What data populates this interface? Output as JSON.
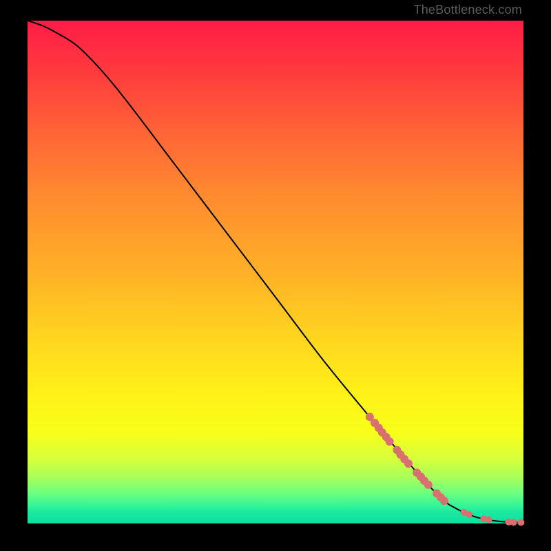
{
  "watermark": "TheBottleneck.com",
  "marker_color": "#d87070",
  "line_color": "#000000",
  "chart_data": {
    "type": "line",
    "title": "",
    "xlabel": "",
    "ylabel": "",
    "xlim": [
      0,
      100
    ],
    "ylim": [
      0,
      100
    ],
    "series": [
      {
        "name": "curve",
        "x": [
          0,
          3,
          6,
          10,
          15,
          20,
          30,
          40,
          50,
          60,
          70,
          76,
          80,
          84,
          86,
          88,
          90,
          92,
          94,
          96,
          98,
          100
        ],
        "y": [
          100,
          99,
          97.5,
          95,
          90,
          84,
          71,
          58,
          45,
          32,
          20,
          13,
          8.5,
          4.5,
          3.2,
          2.2,
          1.4,
          0.9,
          0.55,
          0.35,
          0.25,
          0.2
        ]
      }
    ],
    "markers": {
      "name": "dots",
      "x": [
        69.0,
        70.0,
        70.8,
        71.5,
        72.3,
        73.0,
        74.5,
        75.2,
        76.0,
        76.8,
        78.5,
        79.3,
        80.0,
        80.8,
        82.5,
        83.3,
        84.0,
        88,
        89,
        92,
        93,
        97,
        98,
        99.5
      ],
      "y": [
        21.2,
        20.0,
        19.0,
        18.1,
        17.2,
        16.3,
        14.6,
        13.7,
        12.8,
        11.9,
        10.1,
        9.3,
        8.5,
        7.7,
        6.0,
        5.2,
        4.5,
        2.2,
        1.8,
        0.9,
        0.75,
        0.3,
        0.25,
        0.22
      ],
      "r": [
        6,
        6,
        6,
        6,
        6,
        6,
        6,
        6,
        6,
        6,
        6,
        6,
        6,
        6,
        6,
        6,
        6,
        5,
        5,
        5,
        5,
        5,
        5,
        5
      ]
    }
  }
}
